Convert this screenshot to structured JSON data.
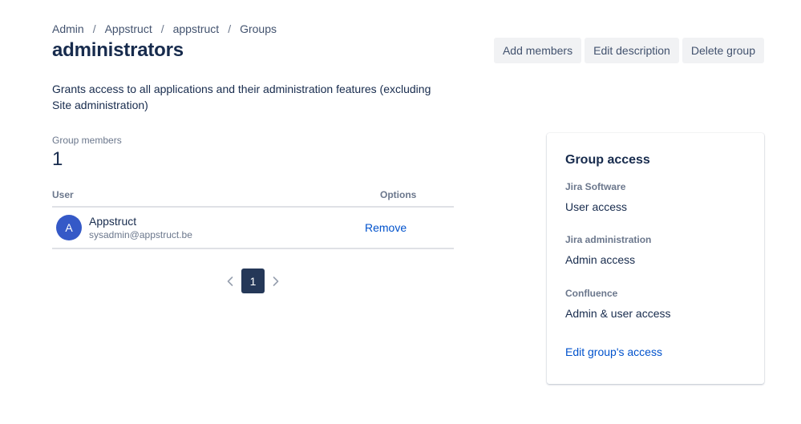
{
  "breadcrumb": [
    "Admin",
    "Appstruct",
    "appstruct",
    "Groups"
  ],
  "title": "administrators",
  "actions": {
    "add_members": "Add members",
    "edit_description": "Edit description",
    "delete_group": "Delete group"
  },
  "description": "Grants access to all applications and their administration features (excluding Site administration)",
  "members": {
    "label": "Group members",
    "count": "1"
  },
  "table": {
    "headers": {
      "user": "User",
      "options": "Options"
    },
    "rows": [
      {
        "initial": "A",
        "name": "Appstruct",
        "email": "sysadmin@appstruct.be",
        "action": "Remove"
      }
    ]
  },
  "pagination": {
    "prev_icon": "chevron-left-icon",
    "current": "1",
    "next_icon": "chevron-right-icon"
  },
  "group_access": {
    "title": "Group access",
    "items": [
      {
        "product": "Jira Software",
        "level": "User access"
      },
      {
        "product": "Jira administration",
        "level": "Admin access"
      },
      {
        "product": "Confluence",
        "level": "Admin & user access"
      }
    ],
    "edit_link": "Edit group's access"
  },
  "colors": {
    "primary_text": "#172b4d",
    "secondary_text": "#6b778c",
    "link": "#0052cc",
    "button_bg": "#f1f2f4",
    "avatar_bg": "#3559c7",
    "pagination_current_bg": "#253858"
  }
}
